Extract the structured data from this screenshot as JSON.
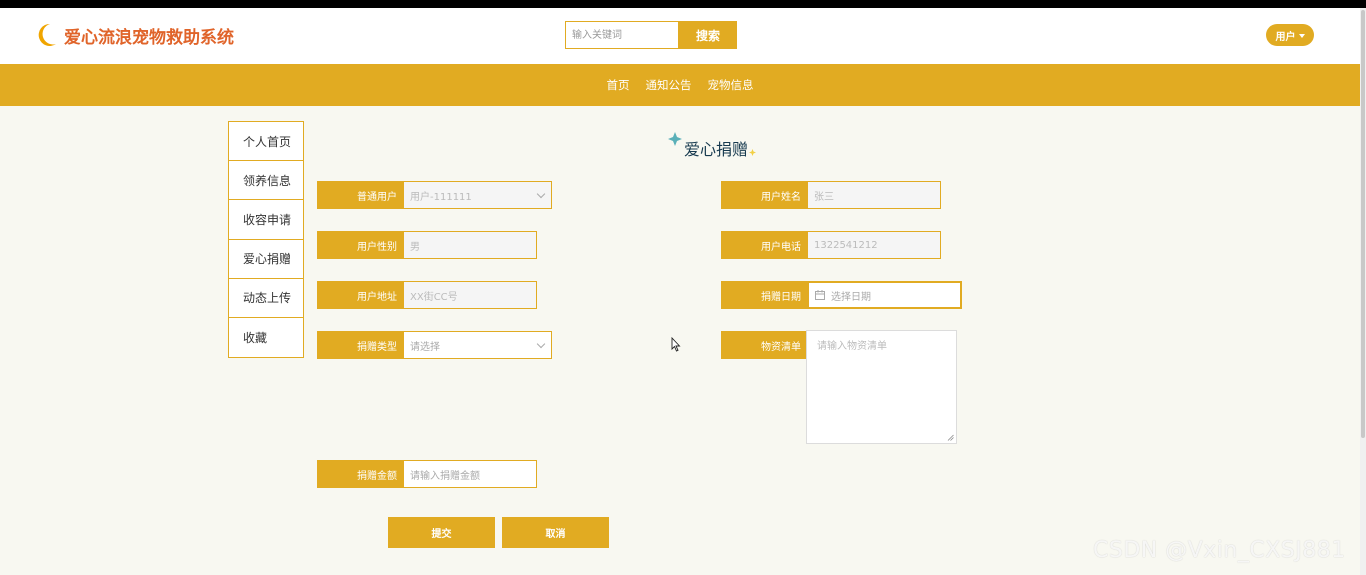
{
  "header": {
    "site_title": "爱心流浪宠物救助系统",
    "search": {
      "placeholder": "输入关键词",
      "button_label": "搜索"
    },
    "user_menu_label": "用户"
  },
  "nav": {
    "items": [
      "首页",
      "通知公告",
      "宠物信息"
    ]
  },
  "sidebar": {
    "items": [
      "个人首页",
      "领养信息",
      "收容申请",
      "爱心捐赠",
      "动态上传",
      "收藏"
    ]
  },
  "form": {
    "title": "爱心捐赠",
    "fields": {
      "user_account": {
        "label": "普通用户",
        "value": "用户-111111"
      },
      "user_name": {
        "label": "用户姓名",
        "value": "张三"
      },
      "user_gender": {
        "label": "用户性别",
        "value": "男"
      },
      "user_phone": {
        "label": "用户电话",
        "value": "1322541212"
      },
      "user_address": {
        "label": "用户地址",
        "value": "XX街CC号"
      },
      "donation_date": {
        "label": "捐赠日期",
        "placeholder": "选择日期"
      },
      "donation_type": {
        "label": "捐赠类型",
        "placeholder": "请选择"
      },
      "materials_list": {
        "label": "物资清单",
        "placeholder": "请输入物资清单"
      },
      "donation_amount": {
        "label": "捐赠金额",
        "placeholder": "请输入捐赠金额"
      }
    },
    "submit_label": "提交",
    "cancel_label": "取消"
  },
  "watermark": "CSDN @Vxin_CXSJ881",
  "colors": {
    "accent": "#e1ab22",
    "background": "#f8f8f1",
    "logo_text": "#e0642a",
    "title_text": "#173a4f"
  }
}
